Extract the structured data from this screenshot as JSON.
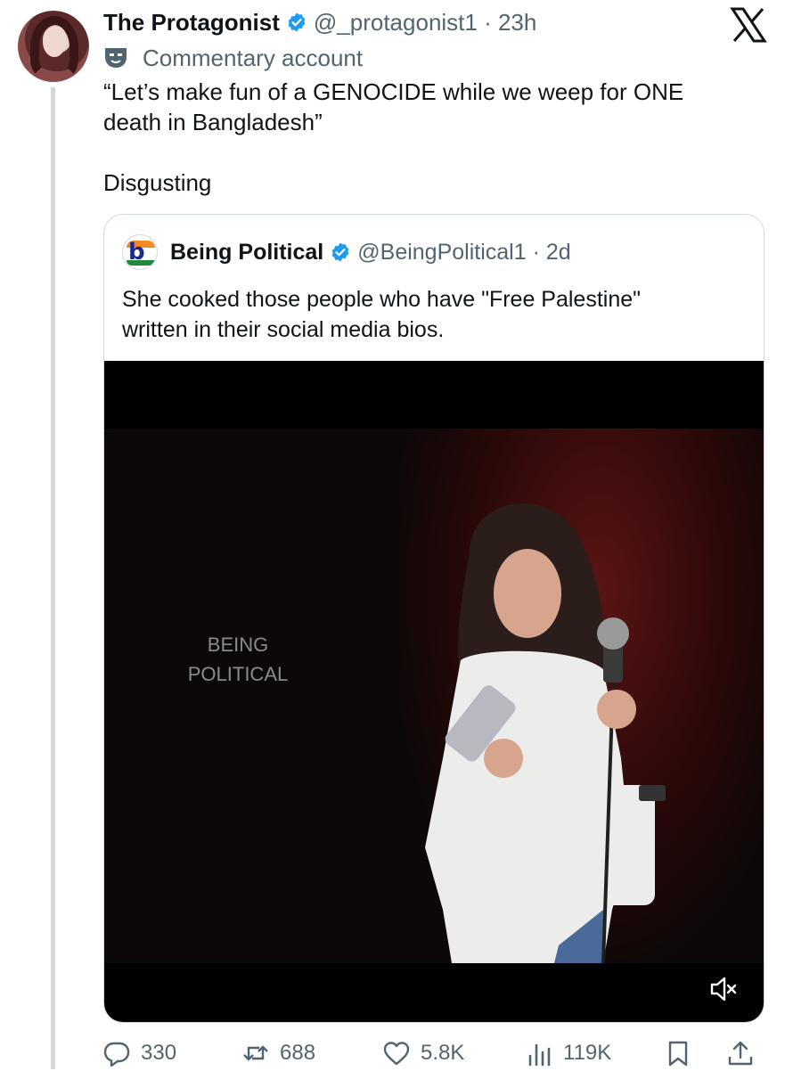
{
  "tweet": {
    "author_name": "The Protagonist",
    "handle_time": "@_protagonist1 · 23h",
    "label": "Commentary account",
    "text_line1": "“Let’s make fun of a GENOCIDE while we weep for ONE",
    "text_line2": "death in Bangladesh”",
    "text_line3": "Disgusting"
  },
  "quote": {
    "author_name": "Being Political",
    "handle_time": "@BeingPolitical1 · 2d",
    "text_line1": "She cooked those people who have \"Free Palestine\"",
    "text_line2": "written in their social media bios.",
    "watermark_line1": "BEING",
    "watermark_line2": "POLITICAL"
  },
  "actions": {
    "replies": "330",
    "reposts": "688",
    "likes": "5.8K",
    "views": "119K"
  },
  "colors": {
    "accent": "#1d9bf0",
    "secondary_text": "#536471",
    "border": "#cfd9de"
  },
  "icons": [
    "x-logo-icon",
    "verified-badge-icon",
    "commentary-mask-icon",
    "mute-icon",
    "reply-icon",
    "repost-icon",
    "like-icon",
    "views-icon",
    "bookmark-icon",
    "share-icon"
  ]
}
